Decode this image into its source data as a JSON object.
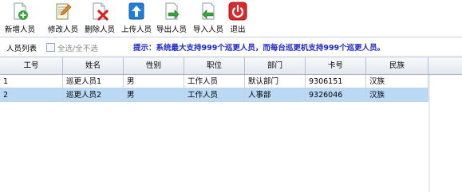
{
  "toolbar": {
    "buttons": [
      {
        "label": "新增人员",
        "icon": "add-person-icon"
      },
      {
        "label": "修改人员",
        "icon": "edit-notepad-icon"
      },
      {
        "label": "删除人员",
        "icon": "delete-document-icon"
      },
      {
        "label": "上传人员",
        "icon": "upload-arrow-icon"
      },
      {
        "label": "导出人员",
        "icon": "export-arrow-icon"
      },
      {
        "label": "导入人员",
        "icon": "import-arrow-icon"
      },
      {
        "label": "退出",
        "icon": "power-icon"
      }
    ]
  },
  "list": {
    "title": "人员列表",
    "select_all_label": "全选/全不选",
    "hint": "提示：系统最大支持999个巡更人员，而每台巡更机支持999个巡更人员。"
  },
  "table": {
    "columns": [
      "工号",
      "姓名",
      "性别",
      "职位",
      "部门",
      "卡号",
      "民族"
    ],
    "rows": [
      [
        "1",
        "巡更人员1",
        "男",
        "工作人员",
        "默认部门",
        "9306151",
        "汉族"
      ],
      [
        "2",
        "巡更人员2",
        "男",
        "工作人员",
        "人事部",
        "9326046",
        "汉族"
      ]
    ],
    "selected_row": 2
  },
  "colors": {
    "hint": "#1d27c9",
    "selection": "#b9d9f5",
    "header_bg": "#e3e8ee"
  }
}
